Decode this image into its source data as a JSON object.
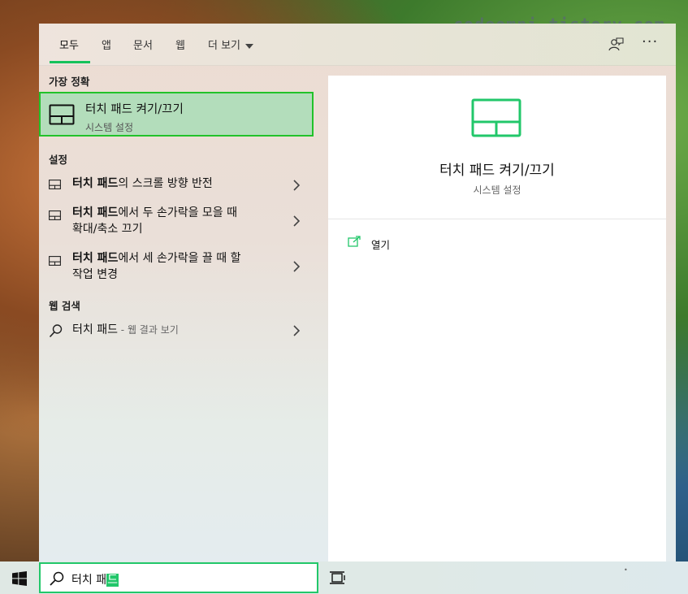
{
  "watermark": "codeomni.tistory.com",
  "tabs": [
    {
      "label": "모두",
      "active": true
    },
    {
      "label": "앱"
    },
    {
      "label": "문서"
    },
    {
      "label": "웹"
    },
    {
      "label": "더 보기"
    }
  ],
  "left": {
    "best_match_header": "가장 정확",
    "best_match": {
      "title": "터치 패드 켜기/끄기",
      "subtitle": "시스템 설정",
      "icon": "touchpad-icon"
    },
    "settings_header": "설정",
    "settings": [
      {
        "bold": "터치 패드",
        "rest": "의 스크롤 방향 반전",
        "line2": ""
      },
      {
        "bold": "터치 패드",
        "rest": "에서 두 손가락을 모을 때",
        "line2": "확대/축소 끄기"
      },
      {
        "bold": "터치 패드",
        "rest": "에서 세 손가락을 끌 때 할",
        "line2": "작업 변경"
      }
    ],
    "web_header": "웹 검색",
    "web": {
      "text": "터치 패드",
      "suffix": " - 웹 결과 보기"
    }
  },
  "right": {
    "title": "터치 패드 켜기/끄기",
    "subtitle": "시스템 설정",
    "actions": [
      {
        "label": "열기",
        "icon": "open-external-icon"
      }
    ]
  },
  "search": {
    "typed": "터치 패",
    "highlight": "드"
  },
  "colors": {
    "accent": "#22c76a",
    "best_bg": "#b3ddbb",
    "best_border": "#22c22a"
  }
}
